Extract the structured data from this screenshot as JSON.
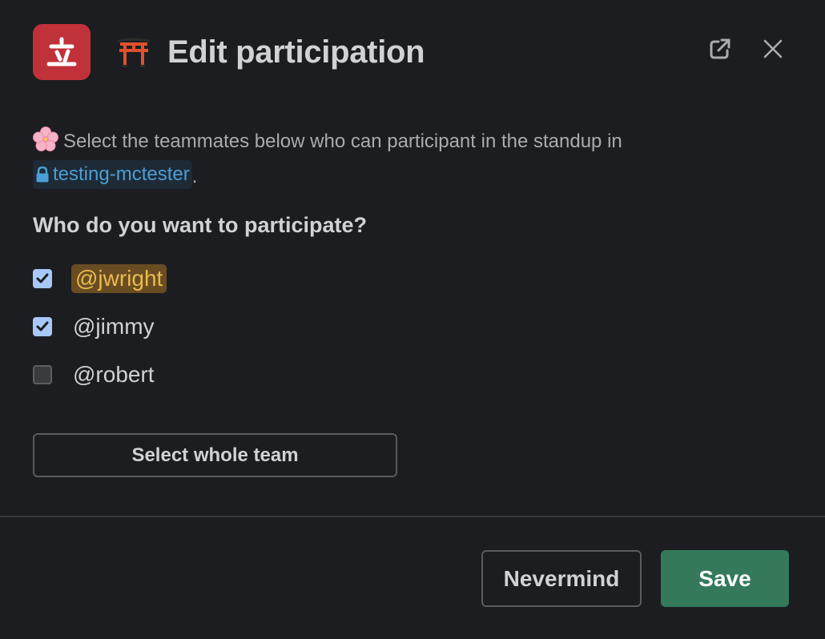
{
  "modal": {
    "app_icon": "app-logo-icon",
    "title_emoji": "torii-gate-icon",
    "title": "Edit participation",
    "actions": {
      "open_external_icon": "external-link-icon",
      "close_icon": "close-icon"
    }
  },
  "intro": {
    "emoji": "cherry-blossom-icon",
    "text": "Select the teammates below who can participant in the standup in",
    "channel": {
      "icon": "lock-icon",
      "name": "testing-mctester",
      "color": "#4a9fd6"
    },
    "trailing": "."
  },
  "question": "Who do you want to participate?",
  "participants": [
    {
      "label": "@jwright",
      "checked": true,
      "highlight": true
    },
    {
      "label": "@jimmy",
      "checked": true,
      "highlight": false
    },
    {
      "label": "@robert",
      "checked": false,
      "highlight": false
    }
  ],
  "select_team_button": "Select whole team",
  "footer": {
    "cancel_label": "Nevermind",
    "save_label": "Save"
  },
  "colors": {
    "background": "#1b1d21",
    "app_icon_bg": "#c0313a",
    "checkbox_checked": "#a8c8fa",
    "mention_bg": "#6a4c23",
    "mention_text": "#e8bc4c",
    "primary_button": "#347a5a"
  }
}
